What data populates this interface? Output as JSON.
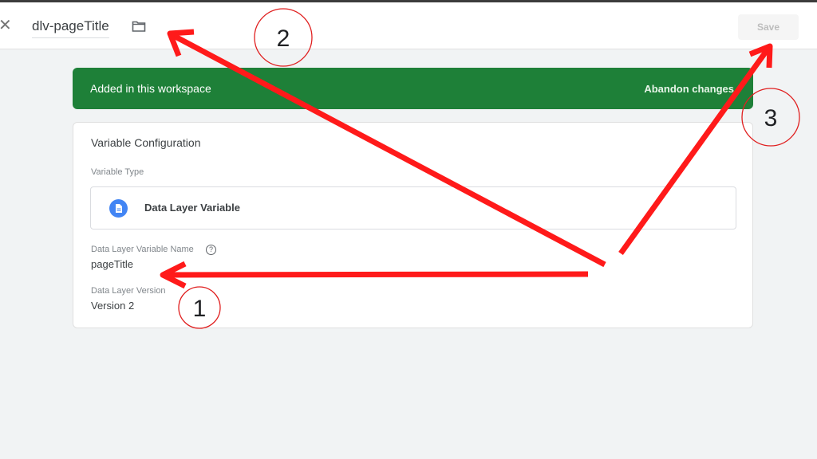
{
  "header": {
    "title": "dlv-pageTitle",
    "save_label": "Save"
  },
  "banner": {
    "text": "Added in this workspace",
    "action": "Abandon changes",
    "color": "#1e8038"
  },
  "card": {
    "title": "Variable Configuration",
    "variable_type_label": "Variable Type",
    "variable_type_value": "Data Layer Variable",
    "dlv_name_label": "Data Layer Variable Name",
    "dlv_name_value": "pageTitle",
    "dlv_version_label": "Data Layer Version",
    "dlv_version_value": "Version 2"
  },
  "annotations": {
    "markers": [
      "1",
      "2",
      "3"
    ],
    "color": "#ff1a1a"
  }
}
